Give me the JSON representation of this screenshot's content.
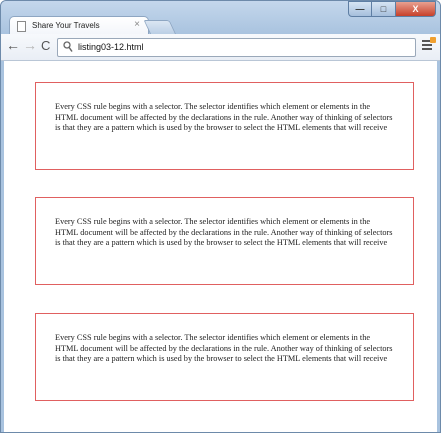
{
  "browser": {
    "tab_title": "Share Your Travels",
    "tab_close_glyph": "×",
    "url": "listing03-12.html",
    "nav_back_glyph": "←",
    "nav_forward_glyph": "→",
    "reload_glyph": "C",
    "window_controls": {
      "minimize": "—",
      "maximize": "□",
      "close": "X"
    }
  },
  "page": {
    "paragraphs": [
      "Every CSS rule begins with a selector. The selector identifies which element or elements in the HTML document will be affected by the declarations in the rule. Another way of thinking of selectors is that they are a pattern which is used by the browser to select the HTML elements that will receive",
      "Every CSS rule begins with a selector. The selector identifies which element or elements in the HTML document will be affected by the declarations in the rule. Another way of thinking of selectors is that they are a pattern which is used by the browser to select the HTML elements that will receive",
      "Every CSS rule begins with a selector. The selector identifies which element or elements in the HTML document will be affected by the declarations in the rule. Another way of thinking of selectors is that they are a pattern which is used by the browser to select the HTML elements that will receive"
    ]
  },
  "colors": {
    "box_border": "#e06060",
    "window_frame": "#a9c3df"
  }
}
